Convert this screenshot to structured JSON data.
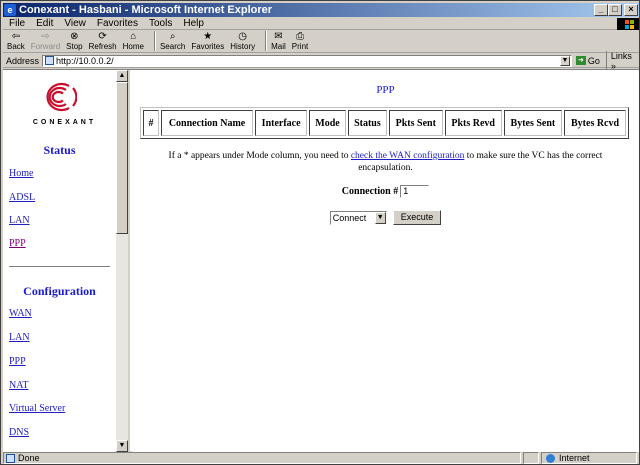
{
  "window": {
    "title": "Conexant - Hasbani - Microsoft Internet Explorer",
    "minimize": "_",
    "maximize": "□",
    "close": "×"
  },
  "menu": {
    "items": [
      {
        "label": "File"
      },
      {
        "label": "Edit"
      },
      {
        "label": "View"
      },
      {
        "label": "Favorites"
      },
      {
        "label": "Tools"
      },
      {
        "label": "Help"
      }
    ]
  },
  "toolbar": {
    "back": "Back",
    "forward": "Forward",
    "stop": "Stop",
    "refresh": "Refresh",
    "home": "Home",
    "search": "Search",
    "favorites": "Favorites",
    "history": "History",
    "mail": "Mail",
    "print": "Print"
  },
  "address": {
    "label": "Address",
    "url": "http://10.0.0.2/",
    "go": "Go",
    "links": "Links"
  },
  "sidebar": {
    "logo_text": "CONEXANT",
    "status_heading": "Status",
    "status_links": [
      {
        "label": "Home"
      },
      {
        "label": "ADSL"
      },
      {
        "label": "LAN"
      },
      {
        "label": "PPP"
      }
    ],
    "config_heading": "Configuration",
    "config_links": [
      {
        "label": "WAN"
      },
      {
        "label": "LAN"
      },
      {
        "label": "PPP"
      },
      {
        "label": "NAT"
      },
      {
        "label": "Virtual Server"
      },
      {
        "label": "DNS"
      }
    ]
  },
  "main": {
    "title": "PPP",
    "columns": [
      "#",
      "Connection Name",
      "Interface",
      "Mode",
      "Status",
      "Pkts Sent",
      "Pkts Revd",
      "Bytes Sent",
      "Bytes Rcvd"
    ],
    "info_before": "If a * appears under Mode column, you need to ",
    "info_link": "check the WAN configuration",
    "info_after": " to make sure the VC has the correct encapsulation.",
    "connection_label": "Connection #",
    "connection_value": "1",
    "action_selected": "Connect",
    "execute_label": "Execute"
  },
  "status": {
    "text": "Done",
    "zone": "Internet"
  },
  "colors": {
    "title_bar": "#0a246a",
    "link": "#2020c0",
    "heading": "#1a1acc"
  }
}
